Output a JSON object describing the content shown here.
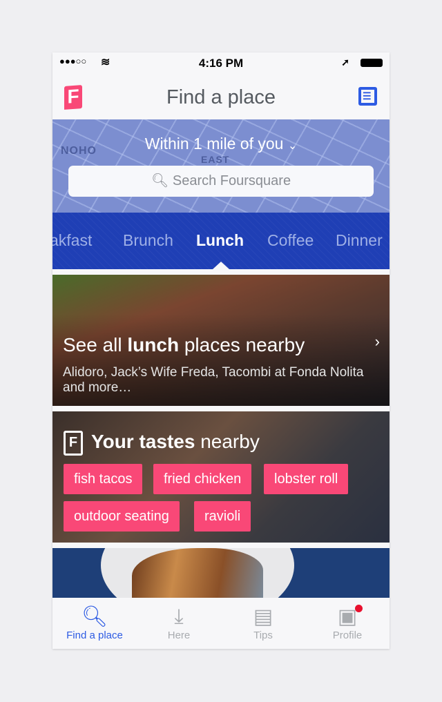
{
  "status": {
    "time": "4:16 PM",
    "signal": "●●●○○"
  },
  "nav": {
    "title": "Find a place"
  },
  "map": {
    "labels": [
      "NOHO",
      "EAST"
    ],
    "within": "Within 1 mile of you",
    "search_placeholder": "Search Foursquare"
  },
  "categories": [
    {
      "label": "akfast"
    },
    {
      "label": "Brunch"
    },
    {
      "label": "Lunch",
      "active": true
    },
    {
      "label": "Coffee"
    },
    {
      "label": "Dinner"
    }
  ],
  "lunch": {
    "pre": "See all ",
    "bold": "lunch",
    "post": " places nearby",
    "sub": "Alidoro, Jack’s Wife Freda, Tacombi at Fonda Nolita and more…"
  },
  "tastes": {
    "bold": "Your tastes",
    "post": " nearby",
    "tags": [
      "fish tacos",
      "fried chicken",
      "lobster roll",
      "outdoor seating",
      "ravioli"
    ]
  },
  "tabs": [
    {
      "label": "Find a place",
      "icon": "search-icon",
      "active": true
    },
    {
      "label": "Here",
      "icon": "download-arrow-icon"
    },
    {
      "label": "Tips",
      "icon": "tips-icon"
    },
    {
      "label": "Profile",
      "icon": "profile-icon",
      "badge": true
    }
  ],
  "colors": {
    "accent": "#2d5be3",
    "brand": "#f94877",
    "category_bar": "#1f3fb5"
  }
}
